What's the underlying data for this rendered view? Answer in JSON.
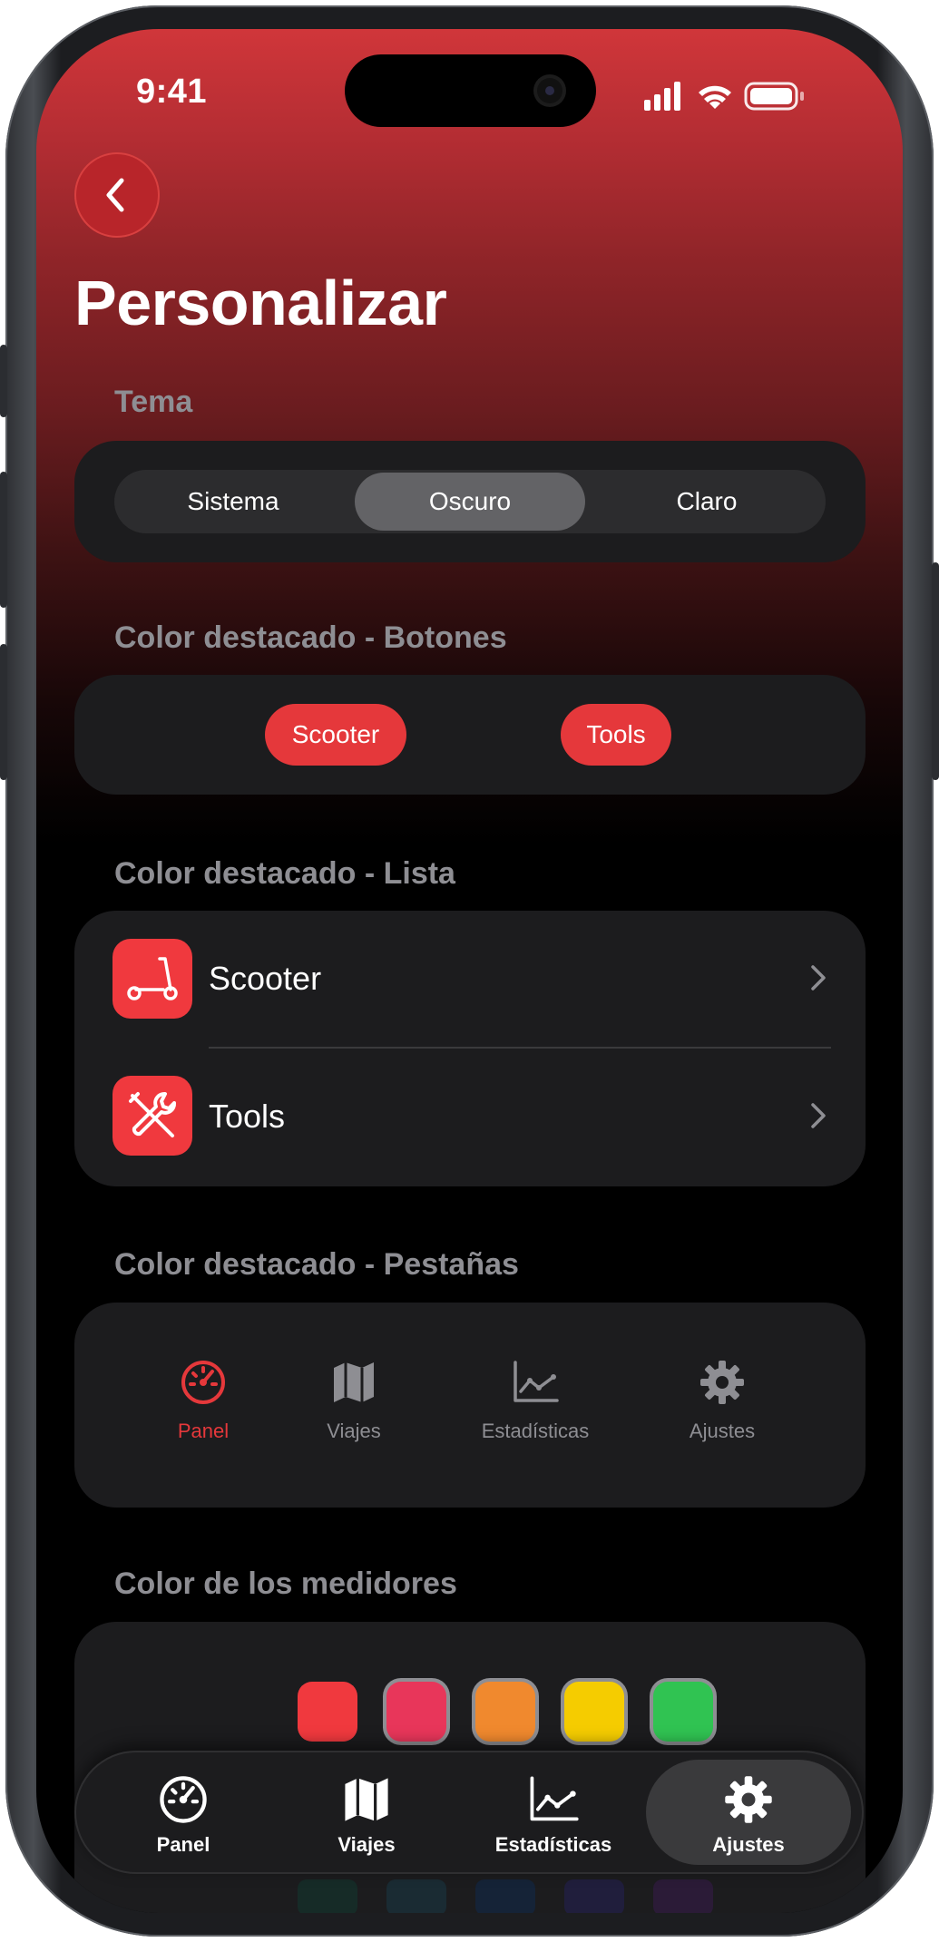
{
  "status_bar": {
    "time": "9:41"
  },
  "header": {
    "title": "Personalizar"
  },
  "theme": {
    "label": "Tema",
    "options": [
      "Sistema",
      "Oscuro",
      "Claro"
    ],
    "selected": "Oscuro"
  },
  "buttons_section": {
    "label": "Color destacado - Botones",
    "buttons": [
      "Scooter",
      "Tools"
    ]
  },
  "list_section": {
    "label": "Color destacado - Lista",
    "items": [
      {
        "label": "Scooter",
        "icon": "scooter-icon"
      },
      {
        "label": "Tools",
        "icon": "tools-icon"
      }
    ]
  },
  "tabs_section": {
    "label": "Color destacado - Pestañas",
    "tabs": [
      {
        "label": "Panel",
        "icon": "gauge-icon",
        "active": true
      },
      {
        "label": "Viajes",
        "icon": "map-icon",
        "active": false
      },
      {
        "label": "Estadísticas",
        "icon": "chart-icon",
        "active": false
      },
      {
        "label": "Ajustes",
        "icon": "gear-icon",
        "active": false
      }
    ]
  },
  "gauges_section": {
    "label": "Color de los medidores",
    "swatches": [
      "#f0393e",
      "#e8365a",
      "#f0892e",
      "#f5cc00",
      "#30c352"
    ]
  },
  "bottom_nav": {
    "items": [
      {
        "label": "Panel",
        "icon": "gauge-icon"
      },
      {
        "label": "Viajes",
        "icon": "map-icon"
      },
      {
        "label": "Estadísticas",
        "icon": "chart-icon"
      },
      {
        "label": "Ajustes",
        "icon": "gear-icon"
      }
    ],
    "selected": "Ajustes"
  },
  "colors": {
    "accent": "#e5383b",
    "card": "#1c1c1e",
    "secondary_text": "#8e8e93"
  }
}
